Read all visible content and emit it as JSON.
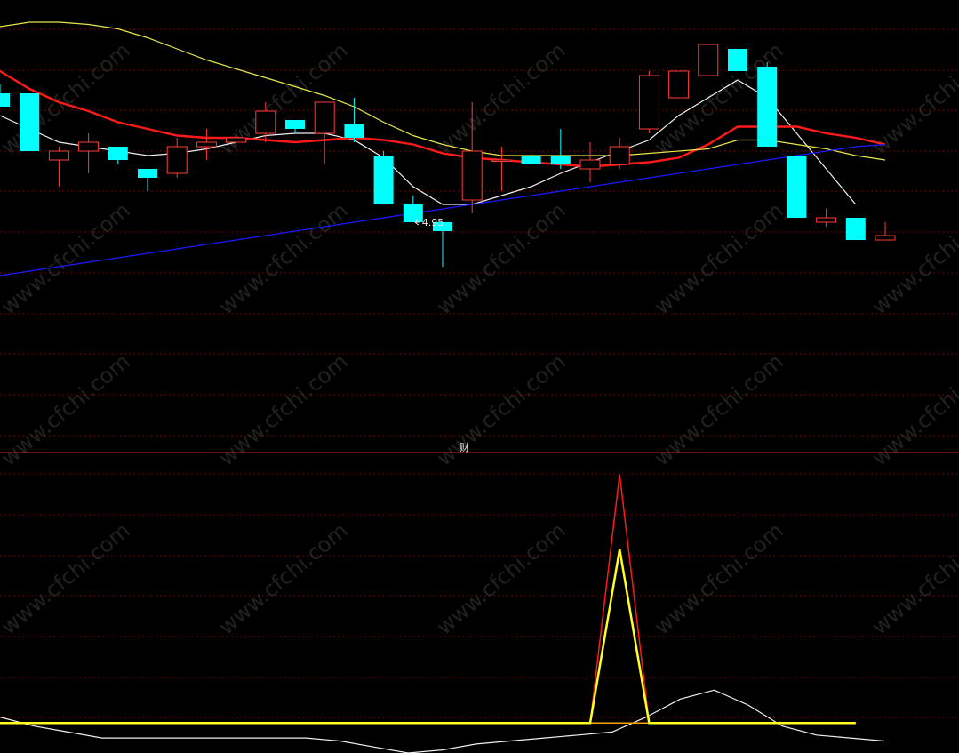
{
  "watermark": "www.cfchi.com",
  "panel_marker": "财",
  "colors": {
    "background": "#000000",
    "grid": "#7a0000",
    "divider": "#cc2020",
    "up_candle": "#ff3b3b",
    "down_candle": "#00ffff",
    "ma_white": "#f0f0f0",
    "ma_red": "#ff1a1a",
    "ma_yellow": "#e6e64a",
    "ma_blue": "#1a1aff",
    "ind_red": "#ff1a1a",
    "ind_yellow": "#ffff22",
    "ind_orange": "#ffa500",
    "ind_white": "#f0f0f0"
  },
  "chart_data": [
    {
      "type": "candlestick",
      "title": "",
      "y_range": [
        4.55,
        5.55
      ],
      "grid": true,
      "low_annotation": {
        "index": 14,
        "label": "4.95"
      },
      "candles": [
        {
          "o": 5.34,
          "h": 5.36,
          "l": 5.31,
          "c": 5.31
        },
        {
          "o": 5.34,
          "h": 5.34,
          "l": 5.21,
          "c": 5.21
        },
        {
          "o": 5.19,
          "h": 5.22,
          "l": 5.13,
          "c": 5.21
        },
        {
          "o": 5.21,
          "h": 5.25,
          "l": 5.16,
          "c": 5.23
        },
        {
          "o": 5.22,
          "h": 5.22,
          "l": 5.18,
          "c": 5.19
        },
        {
          "o": 5.17,
          "h": 5.17,
          "l": 5.12,
          "c": 5.15
        },
        {
          "o": 5.16,
          "h": 5.24,
          "l": 5.15,
          "c": 5.22
        },
        {
          "o": 5.22,
          "h": 5.26,
          "l": 5.19,
          "c": 5.23
        },
        {
          "o": 5.23,
          "h": 5.26,
          "l": 5.21,
          "c": 5.24
        },
        {
          "o": 5.25,
          "h": 5.32,
          "l": 5.23,
          "c": 5.3
        },
        {
          "o": 5.28,
          "h": 5.28,
          "l": 5.25,
          "c": 5.26
        },
        {
          "o": 5.25,
          "h": 5.31,
          "l": 5.18,
          "c": 5.32
        },
        {
          "o": 5.27,
          "h": 5.33,
          "l": 5.23,
          "c": 5.24
        },
        {
          "o": 5.2,
          "h": 5.21,
          "l": 5.09,
          "c": 5.09
        },
        {
          "o": 5.09,
          "h": 5.11,
          "l": 5.05,
          "c": 5.05
        },
        {
          "o": 5.05,
          "h": 5.05,
          "l": 4.95,
          "c": 5.03
        },
        {
          "o": 5.1,
          "h": 5.32,
          "l": 5.07,
          "c": 5.21
        },
        {
          "o": 5.19,
          "h": 5.22,
          "l": 5.12,
          "c": 5.19
        },
        {
          "o": 5.2,
          "h": 5.21,
          "l": 5.18,
          "c": 5.18
        },
        {
          "o": 5.2,
          "h": 5.26,
          "l": 5.17,
          "c": 5.18
        },
        {
          "o": 5.17,
          "h": 5.23,
          "l": 5.14,
          "c": 5.19
        },
        {
          "o": 5.18,
          "h": 5.24,
          "l": 5.17,
          "c": 5.22
        },
        {
          "o": 5.26,
          "h": 5.39,
          "l": 5.25,
          "c": 5.38
        },
        {
          "o": 5.33,
          "h": 5.38,
          "l": 5.33,
          "c": 5.39
        },
        {
          "o": 5.38,
          "h": 5.45,
          "l": 5.38,
          "c": 5.45
        },
        {
          "o": 5.44,
          "h": 5.44,
          "l": 5.39,
          "c": 5.39
        },
        {
          "o": 5.4,
          "h": 5.41,
          "l": 5.22,
          "c": 5.22
        },
        {
          "o": 5.2,
          "h": 5.2,
          "l": 5.06,
          "c": 5.06
        },
        {
          "o": 5.05,
          "h": 5.08,
          "l": 5.04,
          "c": 5.06
        },
        {
          "o": 5.06,
          "h": 5.06,
          "l": 5.01,
          "c": 5.01
        },
        {
          "o": 5.01,
          "h": 5.05,
          "l": 5.01,
          "c": 5.02
        }
      ],
      "series": [
        {
          "color_key": "ma_white",
          "values": [
            5.29,
            5.26,
            5.23,
            5.22,
            5.21,
            5.2,
            5.205,
            5.215,
            5.23,
            5.245,
            5.25,
            5.25,
            5.235,
            5.195,
            5.13,
            5.09,
            5.09,
            5.11,
            5.13,
            5.16,
            5.185,
            5.21,
            5.235,
            5.29,
            5.33,
            5.37,
            5.33,
            5.25,
            5.17,
            5.09
          ]
        },
        {
          "color_key": "ma_red",
          "values": [
            5.39,
            5.35,
            5.32,
            5.3,
            5.275,
            5.26,
            5.245,
            5.24,
            5.24,
            5.235,
            5.23,
            5.235,
            5.24,
            5.235,
            5.225,
            5.205,
            5.195,
            5.19,
            5.185,
            5.18,
            5.175,
            5.18,
            5.185,
            5.195,
            5.225,
            5.265,
            5.265,
            5.265,
            5.25,
            5.24,
            5.225
          ]
        },
        {
          "color_key": "ma_yellow",
          "values": [
            5.49,
            5.5,
            5.5,
            5.495,
            5.485,
            5.465,
            5.44,
            5.415,
            5.395,
            5.375,
            5.355,
            5.335,
            5.31,
            5.275,
            5.245,
            5.225,
            5.21,
            5.2,
            5.2,
            5.2,
            5.2,
            5.2,
            5.205,
            5.21,
            5.215,
            5.235,
            5.235,
            5.225,
            5.215,
            5.2,
            5.19
          ]
        },
        {
          "color_key": "ma_blue",
          "values": [
            4.93,
            4.94,
            4.95,
            4.96,
            4.97,
            4.98,
            4.99,
            5.0,
            5.01,
            5.02,
            5.03,
            5.04,
            5.05,
            5.06,
            5.07,
            5.08,
            5.09,
            5.1,
            5.11,
            5.12,
            5.13,
            5.14,
            5.15,
            5.16,
            5.17,
            5.18,
            5.19,
            5.2,
            5.21,
            5.22,
            5.225
          ]
        }
      ]
    },
    {
      "type": "line",
      "title": "",
      "y_range": [
        0,
        100
      ],
      "grid": true,
      "series": [
        {
          "color_key": "ind_red",
          "values": [
            10,
            10,
            10,
            10,
            10,
            10,
            10,
            10,
            10,
            10,
            10,
            10,
            10,
            10,
            10,
            10,
            10,
            10,
            10,
            10,
            10,
            93,
            10,
            10,
            10,
            10,
            10,
            10,
            10,
            10
          ]
        },
        {
          "color_key": "ind_yellow",
          "values": [
            10,
            10,
            10,
            10,
            10,
            10,
            10,
            10,
            10,
            10,
            10,
            10,
            10,
            10,
            10,
            10,
            10,
            10,
            10,
            10,
            10,
            68,
            10,
            10,
            10,
            10,
            10,
            10,
            10,
            10
          ]
        },
        {
          "color_key": "ind_orange",
          "values": [
            10,
            10,
            10,
            10,
            10,
            10,
            10,
            10,
            10,
            10,
            10,
            10,
            10,
            10,
            10,
            10,
            10,
            10,
            10,
            10,
            10,
            10,
            10,
            10,
            10,
            10,
            10,
            10,
            10,
            10
          ]
        },
        {
          "color_key": "ind_white",
          "values": [
            12,
            9,
            7,
            5,
            5,
            5,
            5,
            5,
            5,
            5,
            4,
            2,
            0,
            1,
            3,
            4,
            5,
            6,
            7,
            12,
            18,
            21,
            16,
            9,
            6,
            5,
            4
          ]
        }
      ]
    }
  ]
}
